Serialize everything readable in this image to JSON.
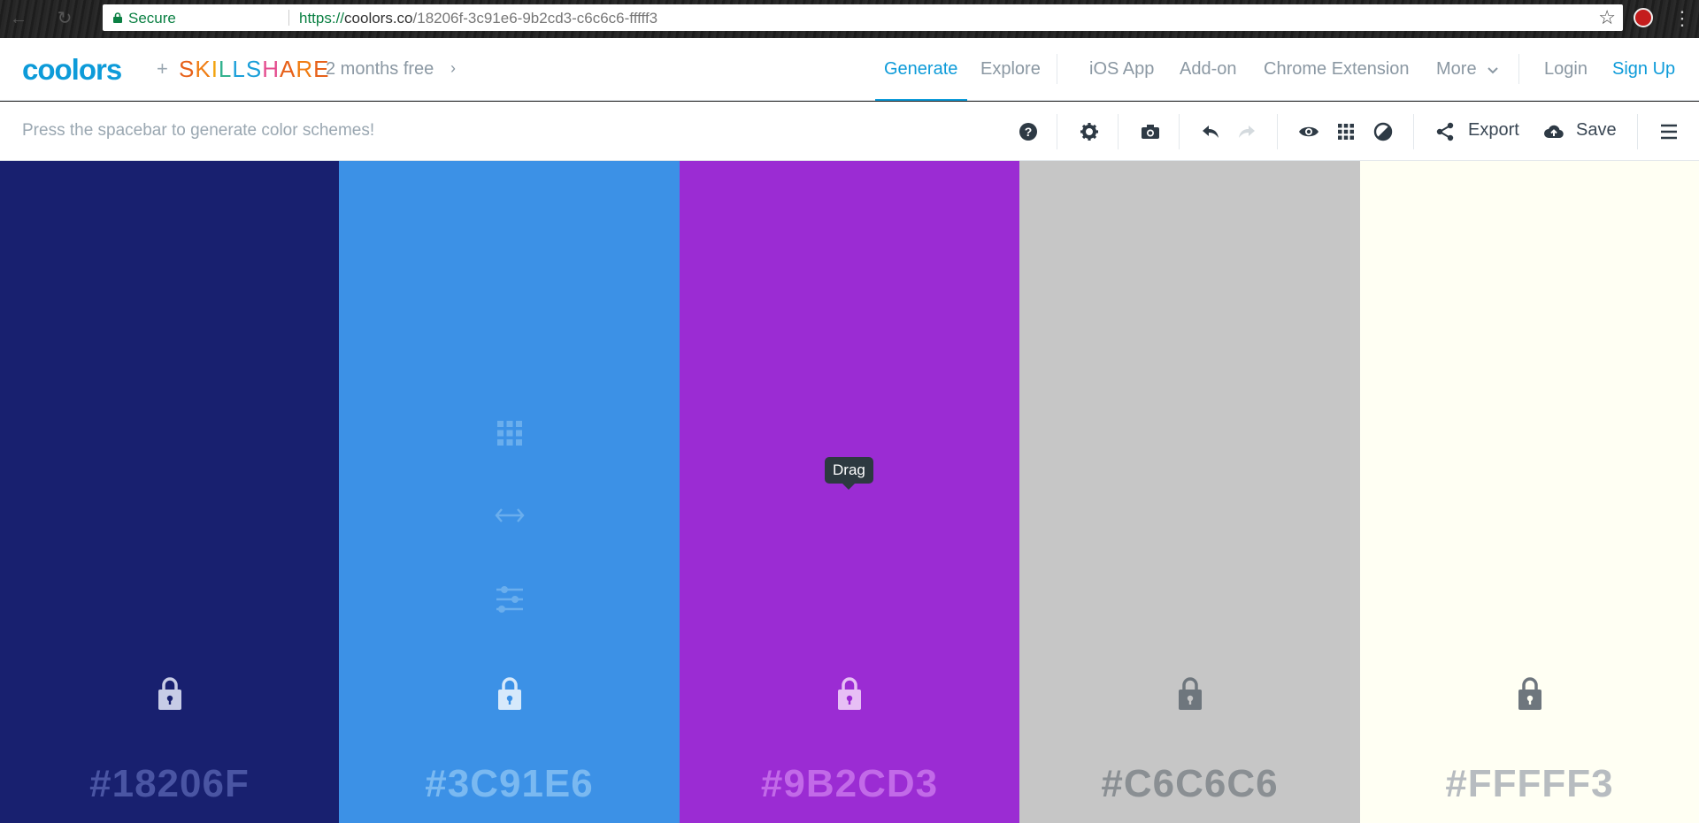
{
  "browser": {
    "secure_label": "Secure",
    "url_scheme": "https://",
    "url_host": "coolors.co",
    "url_path": "/18206f-3c91e6-9b2cd3-c6c6c6-fffff3"
  },
  "nav": {
    "logo": "coolors",
    "plus": "+",
    "partner": [
      "S",
      "K",
      "I",
      "L",
      "L",
      "S",
      "H",
      "A",
      "R",
      "E"
    ],
    "promo": "2 months free",
    "links": {
      "generate": "Generate",
      "explore": "Explore",
      "ios_app": "iOS App",
      "addon": "Add-on",
      "chrome_extension": "Chrome Extension",
      "more": "More",
      "login": "Login",
      "signup": "Sign Up"
    }
  },
  "toolbar": {
    "hint": "Press the spacebar to generate color schemes!",
    "export_label": "Export",
    "save_label": "Save"
  },
  "palette": {
    "tooltip": "Drag",
    "swatches": [
      {
        "hex": "#18206F",
        "color": "#18206f",
        "text_color": "#4a55a3",
        "lock_color": "#c7cce6"
      },
      {
        "hex": "#3C91E6",
        "color": "#3c91e6",
        "text_color": "#7ab9f1",
        "lock_color": "#d6e9fb"
      },
      {
        "hex": "#9B2CD3",
        "color": "#9b2cd3",
        "text_color": "#c26ae8",
        "lock_color": "#e7bff5"
      },
      {
        "hex": "#C6C6C6",
        "color": "#c6c6c6",
        "text_color": "#8a8f93",
        "lock_color": "#6e767d"
      },
      {
        "hex": "#FFFFF3",
        "color": "#fffff3",
        "text_color": "#b7bcc0",
        "lock_color": "#6e767d"
      }
    ]
  }
}
